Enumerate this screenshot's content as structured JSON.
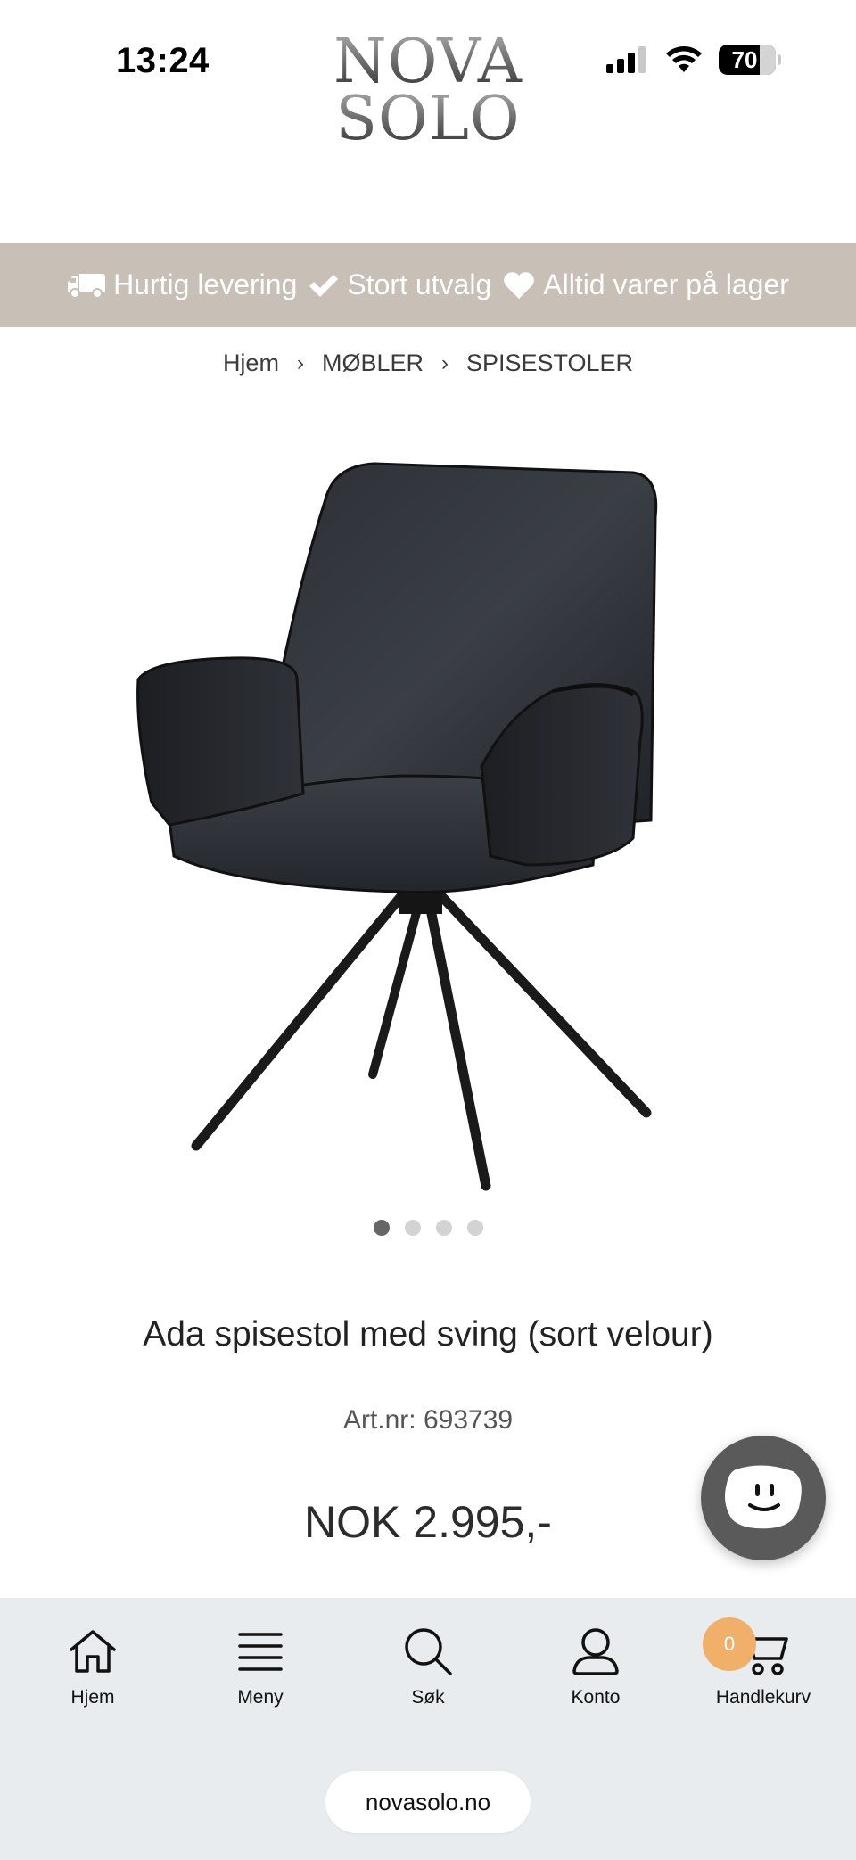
{
  "status_bar": {
    "time": "13:24",
    "battery": "70",
    "battery_level": 0.7
  },
  "logo": {
    "line1": "NOVA",
    "line2": "SOLO"
  },
  "usp": {
    "items": [
      {
        "label": "Hurtig levering",
        "icon": "truck-icon"
      },
      {
        "label": "Stort utvalg",
        "icon": "check-icon"
      },
      {
        "label": "Alltid varer på lager",
        "icon": "heart-icon"
      }
    ]
  },
  "breadcrumb": {
    "items": [
      "Hjem",
      "MØBLER",
      "SPISESTOLER"
    ],
    "separator": "›"
  },
  "gallery": {
    "image_alt": "chair",
    "dot_count": 4,
    "active_index": 0
  },
  "product": {
    "title": "Ada spisestol med sving (sort velour)",
    "sku": "Art.nr: 693739",
    "price": "NOK 2.995,-"
  },
  "bottom_nav": {
    "items": [
      {
        "label": "Hjem",
        "icon": "home-icon"
      },
      {
        "label": "Meny",
        "icon": "menu-icon"
      },
      {
        "label": "Søk",
        "icon": "search-icon"
      },
      {
        "label": "Konto",
        "icon": "user-icon"
      },
      {
        "label": "Handlekurv",
        "icon": "cart-icon"
      }
    ],
    "cart_count": "0"
  },
  "browser": {
    "url": "novasolo.no"
  },
  "colors": {
    "usp_bar": "#c8bfb6",
    "nav_bg": "#e8ecee",
    "badge": "#f0b06a",
    "chat": "#5a5a5a"
  }
}
